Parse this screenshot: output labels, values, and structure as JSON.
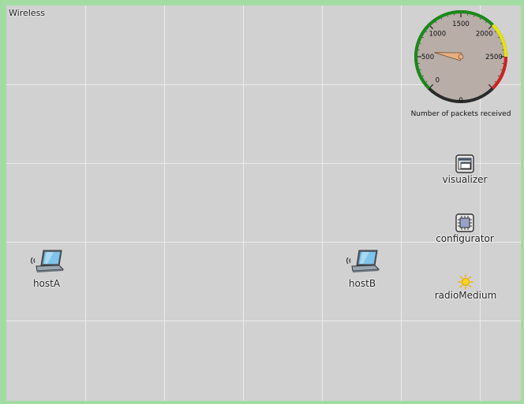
{
  "network": {
    "title": "Wireless"
  },
  "gauge": {
    "caption": "Number of packets received",
    "value": 600,
    "min": 0,
    "max": 3000,
    "tick_labels": [
      "0",
      "500",
      "1000",
      "1500",
      "2000",
      "2500",
      "0"
    ],
    "zones": {
      "green": "#1a8a1a",
      "yellow": "#e6e600",
      "red": "#d22020"
    },
    "face_color": "#b8ada7",
    "needle_color": "#e8b080"
  },
  "nodes": {
    "hostA": {
      "label": "hostA"
    },
    "hostB": {
      "label": "hostB"
    },
    "visualizer": {
      "label": "visualizer"
    },
    "configurator": {
      "label": "configurator"
    },
    "radioMedium": {
      "label": "radioMedium"
    }
  }
}
